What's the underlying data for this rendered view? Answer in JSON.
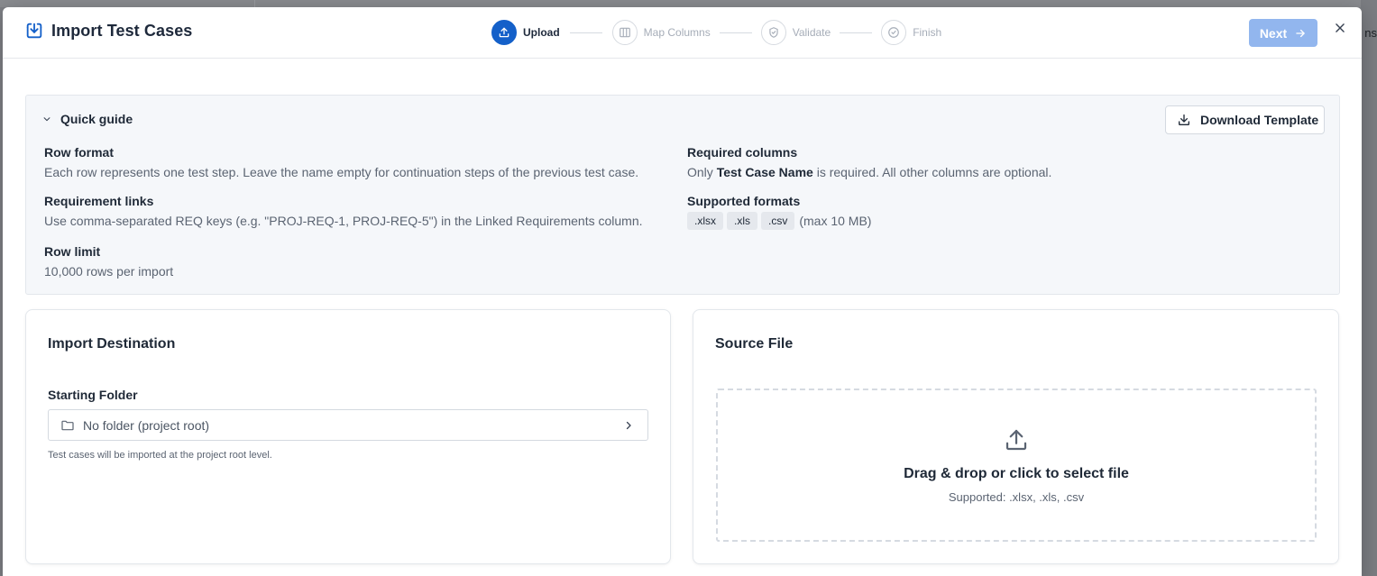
{
  "backdrop": {
    "right_edge_text": "ns"
  },
  "modal": {
    "title": "Import Test Cases",
    "steps": [
      {
        "label": "Upload",
        "state": "active"
      },
      {
        "label": "Map Columns",
        "state": "pending"
      },
      {
        "label": "Validate",
        "state": "pending"
      },
      {
        "label": "Finish",
        "state": "pending"
      }
    ],
    "next_label": "Next",
    "close_icon": "close-icon"
  },
  "guide": {
    "title": "Quick guide",
    "download_label": "Download Template",
    "row_format": {
      "label": "Row format",
      "text": "Each row represents one test step. Leave the name empty for continuation steps of the previous test case."
    },
    "requirement_links": {
      "label": "Requirement links",
      "text": "Use comma-separated REQ keys (e.g. \"PROJ-REQ-1, PROJ-REQ-5\") in the Linked Requirements column."
    },
    "row_limit": {
      "label": "Row limit",
      "text": "10,000 rows per import"
    },
    "required_columns": {
      "label": "Required columns",
      "text_before": "Only ",
      "text_bold": "Test Case Name",
      "text_after": " is required. All other columns are optional."
    },
    "supported_formats": {
      "label": "Supported formats",
      "chips": [
        ".xlsx",
        ".xls",
        ".csv"
      ],
      "note": "(max 10 MB)"
    }
  },
  "destination": {
    "title": "Import Destination",
    "field_label": "Starting Folder",
    "folder_value": "No folder (project root)",
    "helper": "Test cases will be imported at the project root level."
  },
  "source": {
    "title": "Source File",
    "drop_title": "Drag & drop or click to select file",
    "drop_sub": "Supported: .xlsx, .xls, .csv"
  },
  "colors": {
    "primary": "#1460c9",
    "primary_disabled": "#92b6ee"
  }
}
